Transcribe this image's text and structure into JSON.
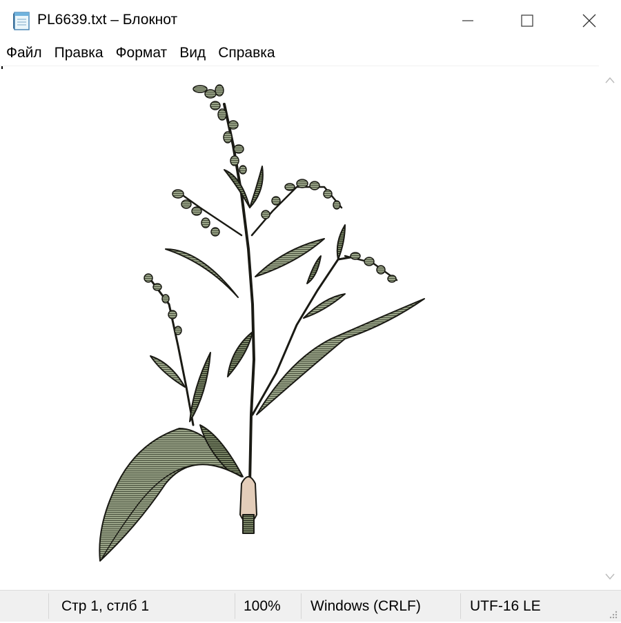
{
  "window": {
    "title": "PL6639.txt – Блокнот",
    "icon": "notepad-icon",
    "controls": [
      "minimize-icon",
      "maximize-icon",
      "close-icon"
    ]
  },
  "menu": {
    "items": [
      {
        "label": "Файл"
      },
      {
        "label": "Правка"
      },
      {
        "label": "Формат"
      },
      {
        "label": "Вид"
      },
      {
        "label": "Справка"
      }
    ]
  },
  "editor": {
    "content": "plant-illustration"
  },
  "status": {
    "position": "Стр 1, стлб 1",
    "zoom": "100%",
    "line_endings": "Windows (CRLF)",
    "encoding": "UTF-16 LE"
  },
  "colors": {
    "leaf": "#8f9a7a",
    "leaf_dark": "#5f6b4c",
    "outline": "#1a1a14",
    "bud": "#e3cdb9"
  }
}
